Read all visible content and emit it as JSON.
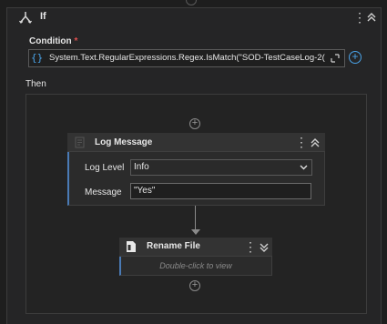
{
  "if_block": {
    "title": "If",
    "icon": "branch-icon"
  },
  "condition": {
    "label": "Condition",
    "required_mark": "*",
    "brace": "{}",
    "value": "System.Text.RegularExpressions.Regex.IsMatch(\"SOD-TestCaseLog-2("
  },
  "then": {
    "label": "Then"
  },
  "log_message": {
    "title": "Log Message",
    "icon": "log-icon",
    "log_level_label": "Log Level",
    "log_level_value": "Info",
    "message_label": "Message",
    "message_value": "\"Yes\""
  },
  "rename_file": {
    "title": "Rename File",
    "icon": "file-icon",
    "hint": "Double-click to view"
  },
  "colors": {
    "accent": "#4aa3e8",
    "card_border_accent": "#4a7ab5",
    "background": "#1e1e1e"
  }
}
